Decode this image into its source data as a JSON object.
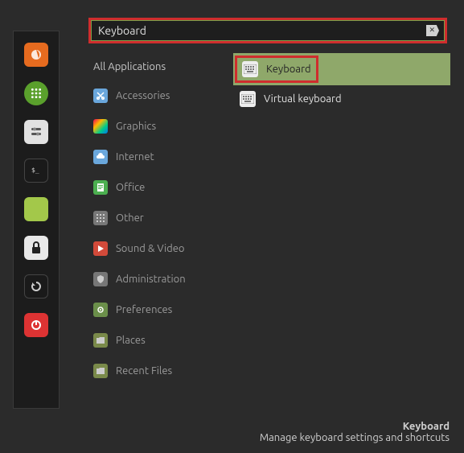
{
  "search": {
    "value": "Keyboard",
    "clear_icon": "backspace-icon"
  },
  "categories": {
    "header": "All Applications",
    "items": [
      {
        "label": "Accessories",
        "icon": "scissors",
        "bg": "#6aa7dc"
      },
      {
        "label": "Graphics",
        "icon": "palette",
        "bg": "linear"
      },
      {
        "label": "Internet",
        "icon": "cloud",
        "bg": "#6aa7dc"
      },
      {
        "label": "Office",
        "icon": "doc",
        "bg": "#4caf50"
      },
      {
        "label": "Other",
        "icon": "grid",
        "bg": "#777"
      },
      {
        "label": "Sound & Video",
        "icon": "play",
        "bg": "#d24a3a"
      },
      {
        "label": "Administration",
        "icon": "shield",
        "bg": "#777"
      },
      {
        "label": "Preferences",
        "icon": "gear",
        "bg": "#6b8f4a"
      },
      {
        "label": "Places",
        "icon": "folder",
        "bg": "#7a8a4a"
      },
      {
        "label": "Recent Files",
        "icon": "folder",
        "bg": "#7a8a4a"
      }
    ]
  },
  "results": [
    {
      "label": "Keyboard",
      "icon": "keyboard",
      "selected": true,
      "highlighted": true
    },
    {
      "label": "Virtual keyboard",
      "icon": "keyboard",
      "selected": false,
      "highlighted": false
    }
  ],
  "footer": {
    "title": "Keyboard",
    "desc": "Manage keyboard settings and shortcuts"
  },
  "launcher": [
    {
      "name": "firefox",
      "bg": "#e66b1f"
    },
    {
      "name": "apps",
      "bg": "#5aa02c"
    },
    {
      "name": "settings",
      "bg": "#e2e2e2"
    },
    {
      "name": "terminal",
      "bg": "#1a1a1a"
    },
    {
      "name": "files",
      "bg": "#a3c84a"
    },
    {
      "name": "lock",
      "bg": "#e8e8e8"
    },
    {
      "name": "reload",
      "bg": "#1a1a1a"
    },
    {
      "name": "power",
      "bg": "#d33"
    }
  ]
}
